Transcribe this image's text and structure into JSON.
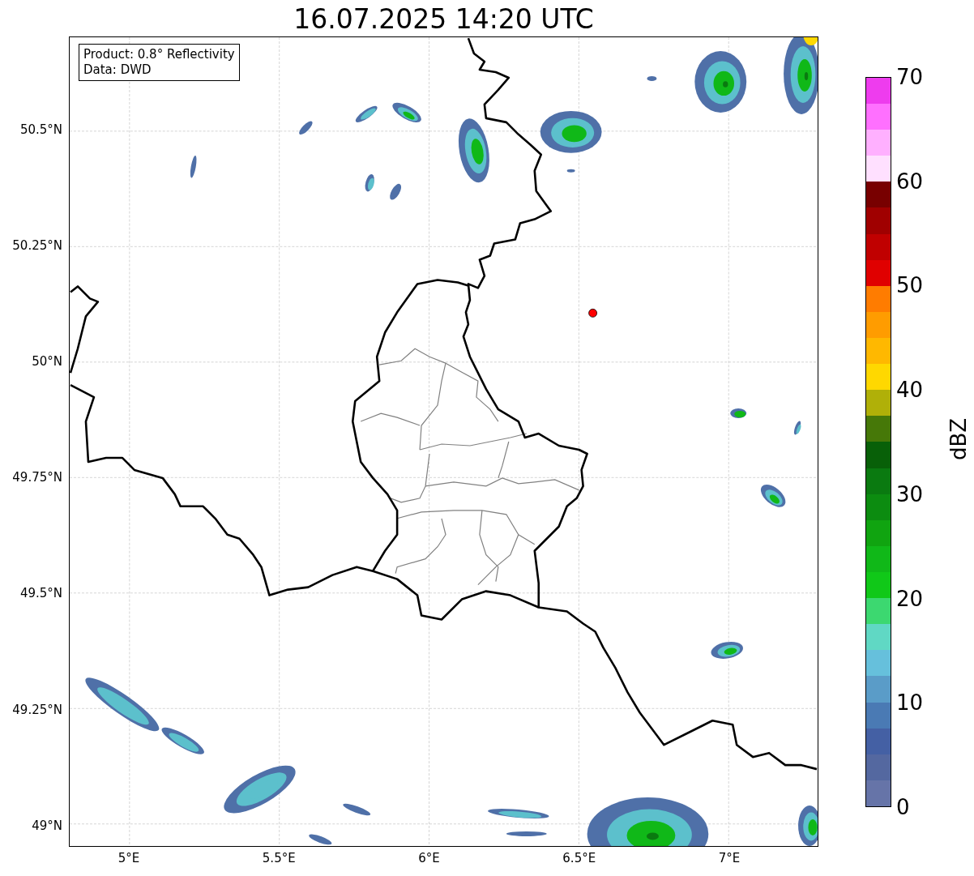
{
  "title": "16.07.2025 14:20 UTC",
  "annotation": {
    "lines": [
      "Product: 0.8° Reflectivity",
      "Data: DWD"
    ]
  },
  "map": {
    "yticks": [
      "50.5°N",
      "50.25°N",
      "50°N",
      "49.75°N",
      "49.5°N",
      "49.25°N",
      "49°N"
    ],
    "xticks": [
      "5°E",
      "5.5°E",
      "6°E",
      "6.5°E",
      "7°E"
    ]
  },
  "colorbar": {
    "label": "dBZ",
    "ticks": [
      "70",
      "60",
      "50",
      "40",
      "30",
      "20",
      "10",
      "0"
    ],
    "segments": [
      {
        "color": "#6674a8"
      },
      {
        "color": "#5468a0"
      },
      {
        "color": "#4460a4"
      },
      {
        "color": "#4a7ab4"
      },
      {
        "color": "#5a9cc8"
      },
      {
        "color": "#66c0dc"
      },
      {
        "color": "#60d8c4"
      },
      {
        "color": "#3cd870"
      },
      {
        "color": "#10c818"
      },
      {
        "color": "#10b818"
      },
      {
        "color": "#10a410"
      },
      {
        "color": "#0c8c10"
      },
      {
        "color": "#0a7a10"
      },
      {
        "color": "#086008"
      },
      {
        "color": "#467808"
      },
      {
        "color": "#b0b008"
      },
      {
        "color": "#ffd800"
      },
      {
        "color": "#ffb800"
      },
      {
        "color": "#ff9c00"
      },
      {
        "color": "#ff7c00"
      },
      {
        "color": "#e00000"
      },
      {
        "color": "#c00000"
      },
      {
        "color": "#a00000"
      },
      {
        "color": "#780000"
      },
      {
        "color": "#ffe0ff"
      },
      {
        "color": "#ffb0ff"
      },
      {
        "color": "#ff70ff"
      },
      {
        "color": "#ee3cee"
      }
    ]
  }
}
